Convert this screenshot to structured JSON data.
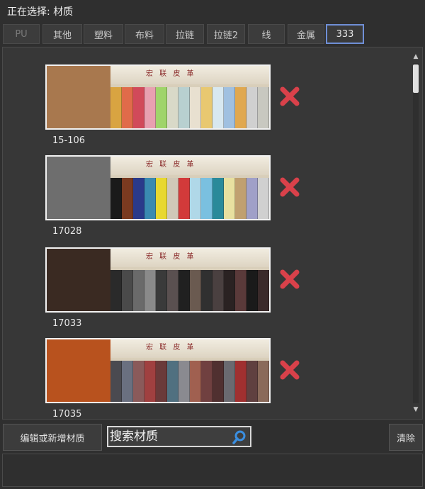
{
  "header": {
    "selecting_label": "正在选择: 材质"
  },
  "tabs": [
    {
      "label": "PU",
      "state": "disabled"
    },
    {
      "label": "其他",
      "state": "normal"
    },
    {
      "label": "塑料",
      "state": "normal"
    },
    {
      "label": "布料",
      "state": "normal"
    },
    {
      "label": "拉链",
      "state": "normal"
    },
    {
      "label": "拉链2",
      "state": "normal"
    },
    {
      "label": "线",
      "state": "normal"
    },
    {
      "label": "金属",
      "state": "normal"
    },
    {
      "label": "333",
      "state": "active"
    }
  ],
  "materials": [
    {
      "code": "15-106",
      "card_title": "宏 联 皮 革",
      "swatch_color": "#a8784e",
      "strip_colors": [
        "#d9a441",
        "#e06b4a",
        "#d14a5a",
        "#e8a0b0",
        "#9fd46a",
        "#d9d9c8",
        "#b8d0d0",
        "#e8e0d0",
        "#e8c870",
        "#d8e8f0",
        "#a0c0e0",
        "#e0a850",
        "#d0d0d0",
        "#c8c8c0"
      ]
    },
    {
      "code": "17028",
      "card_title": "宏 联 皮 革",
      "swatch_color": "#6e6e6e",
      "strip_colors": [
        "#1a1a1a",
        "#7a3a20",
        "#2a3a8a",
        "#3a8ab0",
        "#e8d830",
        "#d0c8b8",
        "#d23a3a",
        "#b0d8e8",
        "#7ac0e0",
        "#2a8a9a",
        "#e8e0a0",
        "#c0a070",
        "#a0a0c8",
        "#d0d0d0"
      ]
    },
    {
      "code": "17033",
      "card_title": "宏 联 皮 革",
      "swatch_color": "#3a2a22",
      "strip_colors": [
        "#2a2a2a",
        "#4a4a4a",
        "#6a6a6a",
        "#8a8a8a",
        "#3a3a3a",
        "#5a5050",
        "#202020",
        "#6a5a50",
        "#303030",
        "#4a4040",
        "#2a2222",
        "#5a3a3a",
        "#1a1a1a",
        "#3a2a2a"
      ]
    },
    {
      "code": "17035",
      "card_title": "宏 联 皮 革",
      "swatch_color": "#b8521e",
      "strip_colors": [
        "#4a4a50",
        "#6a7080",
        "#8a5a5a",
        "#a04040",
        "#6a3a3a",
        "#507080",
        "#8a8a90",
        "#a06050",
        "#704040",
        "#503030",
        "#6a6a70",
        "#a03030",
        "#604040",
        "#8a6a5a"
      ]
    }
  ],
  "footer": {
    "edit_button": "编辑或新增材质",
    "search_placeholder": "搜索材质",
    "clear_button": "清除"
  },
  "colors": {
    "delete_x": "#d9414a",
    "active_tab_border": "#6f8fd6",
    "search_icon": "#3a8ee0"
  }
}
